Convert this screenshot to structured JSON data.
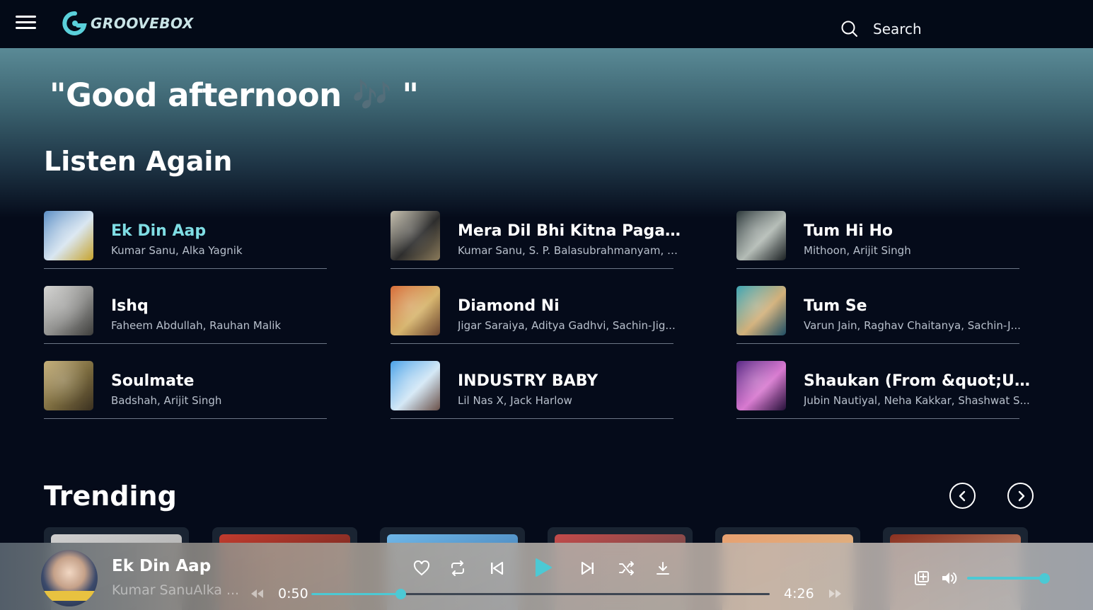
{
  "app": {
    "name": "GROOVEBOX",
    "accent_color": "#4cc9d4",
    "active_text_color": "#7fdde4"
  },
  "header": {
    "search_label": "Search"
  },
  "greeting": "\"Good afternoon 🎶 \"",
  "listen_again": {
    "title": "Listen Again",
    "items": [
      {
        "title": "Ek Din Aap",
        "artist": "Kumar Sanu, Alka Yagnik",
        "active": true,
        "art_colors": [
          "#5c8fc6",
          "#d9e6f1",
          "#c7a32c"
        ]
      },
      {
        "title": "Mera Dil Bhi Kitna Pagal Hai",
        "artist": "Kumar Sanu, S. P. Balasubrahmanyam, A...",
        "active": false,
        "art_colors": [
          "#c8c2b0",
          "#2d2d2d",
          "#8a7a5a"
        ]
      },
      {
        "title": "Tum Hi Ho",
        "artist": "Mithoon, Arijit Singh",
        "active": false,
        "art_colors": [
          "#2e3a3c",
          "#b4bcb6",
          "#1a1f22"
        ]
      },
      {
        "title": "Ishq",
        "artist": "Faheem Abdullah, Rauhan Malik",
        "active": false,
        "art_colors": [
          "#d6d6d4",
          "#8e8e8c",
          "#3d3d3b"
        ]
      },
      {
        "title": "Diamond Ni",
        "artist": "Jigar Saraiya, Aditya Gadhvi, Sachin-Jig...",
        "active": false,
        "art_colors": [
          "#d86e3a",
          "#d7b56e",
          "#6b4530"
        ]
      },
      {
        "title": "Tum Se",
        "artist": "Varun Jain, Raghav Chaitanya, Sachin-J...",
        "active": false,
        "art_colors": [
          "#3fa6b4",
          "#d2b07a",
          "#1f4f66"
        ]
      },
      {
        "title": "Soulmate",
        "artist": "Badshah, Arijit Singh",
        "active": false,
        "art_colors": [
          "#c6b07a",
          "#7a6a3e",
          "#3a3020"
        ]
      },
      {
        "title": "INDUSTRY BABY",
        "artist": "Lil Nas X, Jack Harlow",
        "active": false,
        "art_colors": [
          "#4aa2e8",
          "#d4e8f6",
          "#6a5048"
        ]
      },
      {
        "title": "Shaukan (From &quot;Ula...",
        "artist": "Jubin Nautiyal, Neha Kakkar, Shashwat S...",
        "active": false,
        "art_colors": [
          "#5a2a86",
          "#d87ad0",
          "#241038"
        ]
      }
    ]
  },
  "trending": {
    "title": "Trending",
    "cards": [
      {
        "art_colors": [
          "#cfcfcf",
          "#9a9a9a"
        ]
      },
      {
        "art_colors": [
          "#c23b2e",
          "#3b1c18"
        ]
      },
      {
        "art_colors": [
          "#6fb7e8",
          "#2b5f9a"
        ]
      },
      {
        "art_colors": [
          "#c54a4a",
          "#2a4a4a"
        ]
      },
      {
        "art_colors": [
          "#e8a070",
          "#d3c090"
        ]
      },
      {
        "art_colors": [
          "#8a3020",
          "#e2c09a"
        ]
      }
    ]
  },
  "player": {
    "title": "Ek Din Aap",
    "artist": "Kumar SanuAlka ...",
    "elapsed": "0:50",
    "duration": "4:26",
    "progress_fraction": 0.195,
    "volume_fraction": 1.0
  },
  "icons": {
    "menu": "hamburger-menu-icon",
    "search": "search-icon",
    "prev_page": "chevron-left-icon",
    "next_page": "chevron-right-icon",
    "like": "heart-icon",
    "repeat": "repeat-icon",
    "previous": "skip-previous-icon",
    "play": "play-icon",
    "next": "skip-next-icon",
    "shuffle": "shuffle-icon",
    "download": "download-icon",
    "rewind": "rewind-icon",
    "forward": "fast-forward-icon",
    "queue": "add-to-queue-icon",
    "volume": "volume-icon"
  }
}
